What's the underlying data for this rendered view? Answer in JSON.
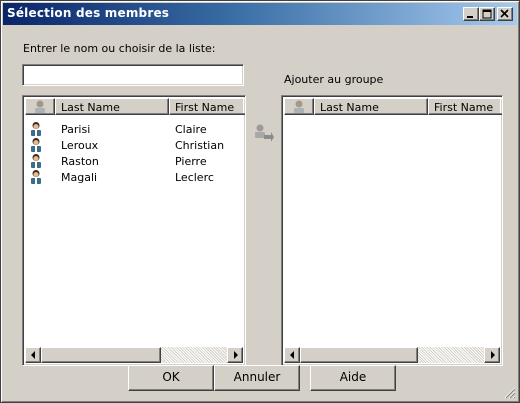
{
  "window": {
    "title": "Sélection des membres"
  },
  "titlebar_buttons": {
    "minimize_icon": "minimize-icon",
    "maximize_icon": "maximize-icon",
    "close_icon": "close-icon"
  },
  "search": {
    "label": "Entrer le nom ou choisir de la liste:",
    "value": "",
    "placeholder": ""
  },
  "group_label": "Ajouter au groupe",
  "source_list": {
    "columns": [
      "",
      "Last Name",
      "First Name"
    ],
    "rows": [
      {
        "last": "Parisi",
        "first": "Claire"
      },
      {
        "last": "Leroux",
        "first": "Christian"
      },
      {
        "last": "Raston",
        "first": "Pierre"
      },
      {
        "last": "Magali",
        "first": "Leclerc"
      }
    ]
  },
  "group_list": {
    "columns": [
      "",
      "Last Name",
      "First Name"
    ],
    "rows": []
  },
  "buttons": {
    "ok": "OK",
    "cancel": "Annuler",
    "help": "Aide"
  },
  "icons": {
    "user": "user-icon",
    "add_to_group": "add-to-group-icon",
    "scroll_left": "scroll-left-arrow-icon",
    "scroll_right": "scroll-right-arrow-icon",
    "resize_grip": "resize-grip-icon"
  },
  "colors": {
    "titlebar_start": "#0a246a",
    "titlebar_end": "#a6caf0",
    "face": "#d4d0c8"
  }
}
